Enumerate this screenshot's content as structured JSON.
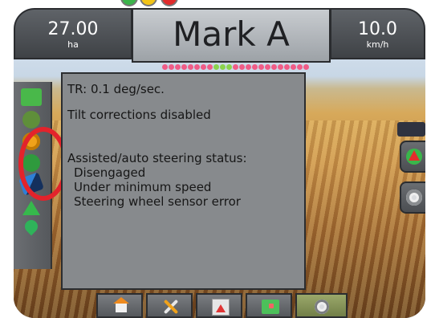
{
  "header": {
    "left_metric": {
      "value": "27.00",
      "unit": "ha"
    },
    "title": "Mark A",
    "right_metric": {
      "value": "10.0",
      "unit": "km/h"
    }
  },
  "status_lights": [
    {
      "icon": "green-status-icon",
      "color": "#3cb44b"
    },
    {
      "icon": "yellow-status-icon",
      "color": "#f2c418"
    },
    {
      "icon": "red-status-icon",
      "color": "#e02b2b"
    }
  ],
  "lightbar": {
    "colors": [
      "#f05c87",
      "#f05c87",
      "#f05c87",
      "#f05c87",
      "#f05c87",
      "#f05c87",
      "#f05c87",
      "#f05c87",
      "#8ad34d",
      "#8ad34d",
      "#8ad34d",
      "#f05c87",
      "#f05c87",
      "#f05c87",
      "#f05c87",
      "#f05c87",
      "#f05c87",
      "#f05c87",
      "#f05c87",
      "#f05c87",
      "#f05c87",
      "#f05c87",
      "#f05c87"
    ]
  },
  "panel": {
    "lines": [
      "TR: 0.1 deg/sec.",
      "Tilt corrections disabled",
      "Assisted/auto steering status:",
      "Disengaged",
      "Under minimum speed",
      "Steering wheel sensor error"
    ]
  },
  "sidebar": {
    "icons": [
      "implement-icon",
      "vehicle-icon",
      "gps-status-icon",
      "steering-status-icon",
      "tilt-status-icon",
      "guidance-arrow-icon",
      "liquid-drop-icon"
    ]
  },
  "right_controls": [
    {
      "icon": "compass-north-icon"
    },
    {
      "icon": "view-target-icon"
    }
  ],
  "bottom_nav": [
    {
      "icon": "home-icon"
    },
    {
      "icon": "tools-icon"
    },
    {
      "icon": "map-view-icon"
    },
    {
      "icon": "marker-icon"
    },
    {
      "icon": "view-target-icon"
    }
  ],
  "accent_colors": {
    "highlight_circle": "#e3232b",
    "panel_background": "#878a8d"
  }
}
